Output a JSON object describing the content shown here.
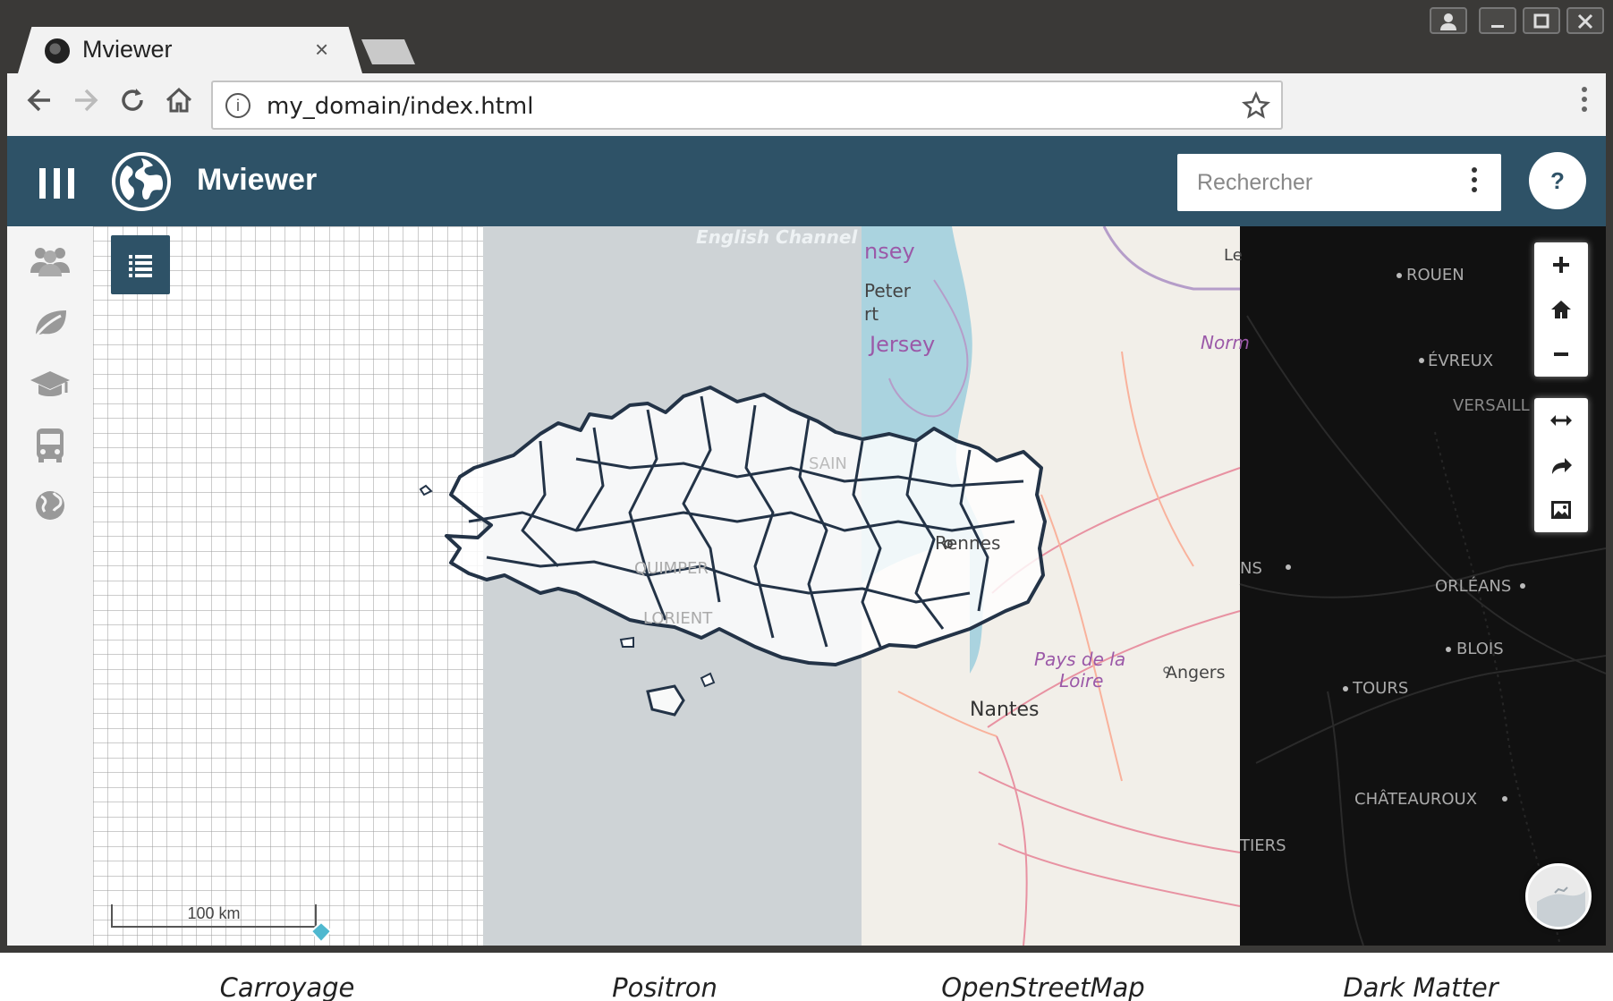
{
  "browser": {
    "tab_title": "Mviewer",
    "tab_close": "×",
    "url": "my_domain/index.html",
    "info": "i"
  },
  "window_controls": [
    "user",
    "minimize",
    "maximize",
    "close"
  ],
  "app": {
    "title": "Mviewer",
    "search_placeholder": "Rechercher",
    "help_label": "?",
    "colors": {
      "header": "#2e5267",
      "dark_matter": "#111111",
      "positron": "#ced3d6",
      "osm": "#f2efe9"
    }
  },
  "sidebar": {
    "items": [
      {
        "icon": "group-icon"
      },
      {
        "icon": "leaf-icon"
      },
      {
        "icon": "graduation-cap-icon"
      },
      {
        "icon": "bus-icon"
      },
      {
        "icon": "globe-icon"
      }
    ]
  },
  "map": {
    "scale": "100 km",
    "controls": [
      "zoom-in",
      "home",
      "zoom-out",
      "measure",
      "share",
      "export-image"
    ],
    "labels": {
      "english_channel": "English Channel",
      "guernsey": "nsey",
      "st_peter": "Peter",
      "rt": "rt",
      "jersey": "Jersey",
      "le": "Le",
      "rouen": "ROUEN",
      "norm": "Norm",
      "evreux": "ÉVREUX",
      "versailles": "VERSAILL",
      "saint_malo": "SAIN",
      "rennes": "Rennes",
      "quimper": "QUIMPER",
      "lorient": "LORIENT",
      "pays_loire_1": "Pays de la",
      "pays_loire_2": "Loire",
      "angers": "Angers",
      "nantes": "Nantes",
      "le_mans": "NS",
      "orleans": "ORLÉANS",
      "blois": "BLOIS",
      "tours": "TOURS",
      "chateauroux": "CHÂTEAUROUX",
      "poitiers": "TIERS"
    }
  },
  "captions": [
    "Carroyage",
    "Positron",
    "OpenStreetMap",
    "Dark Matter"
  ]
}
